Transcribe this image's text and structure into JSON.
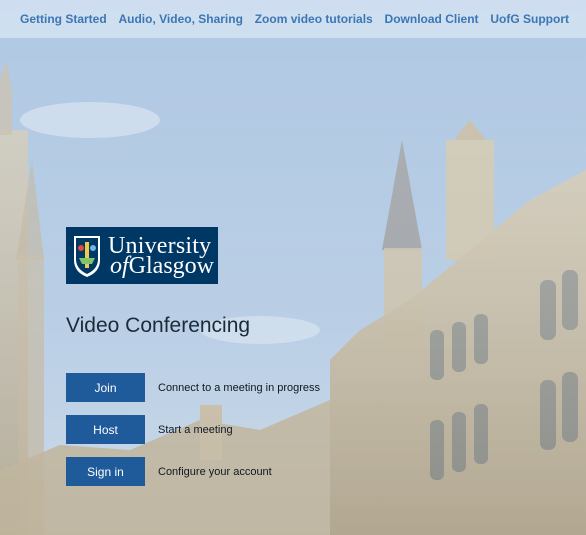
{
  "nav": {
    "items": [
      {
        "label": "Getting Started"
      },
      {
        "label": "Audio, Video, Sharing"
      },
      {
        "label": "Zoom video tutorials"
      },
      {
        "label": "Download Client"
      },
      {
        "label": "UofG Support"
      }
    ]
  },
  "logo": {
    "line1": "University",
    "line2_prefix": "of",
    "line2_name": "Glasgow"
  },
  "page_title": "Video Conferencing",
  "actions": [
    {
      "button": "Join",
      "description": "Connect to a meeting in progress"
    },
    {
      "button": "Host",
      "description": "Start a meeting"
    },
    {
      "button": "Sign in",
      "description": "Configure your account"
    }
  ],
  "colors": {
    "nav_text": "#3d76b5",
    "button_bg": "#1f5a9b",
    "logo_bg": "#003865"
  }
}
